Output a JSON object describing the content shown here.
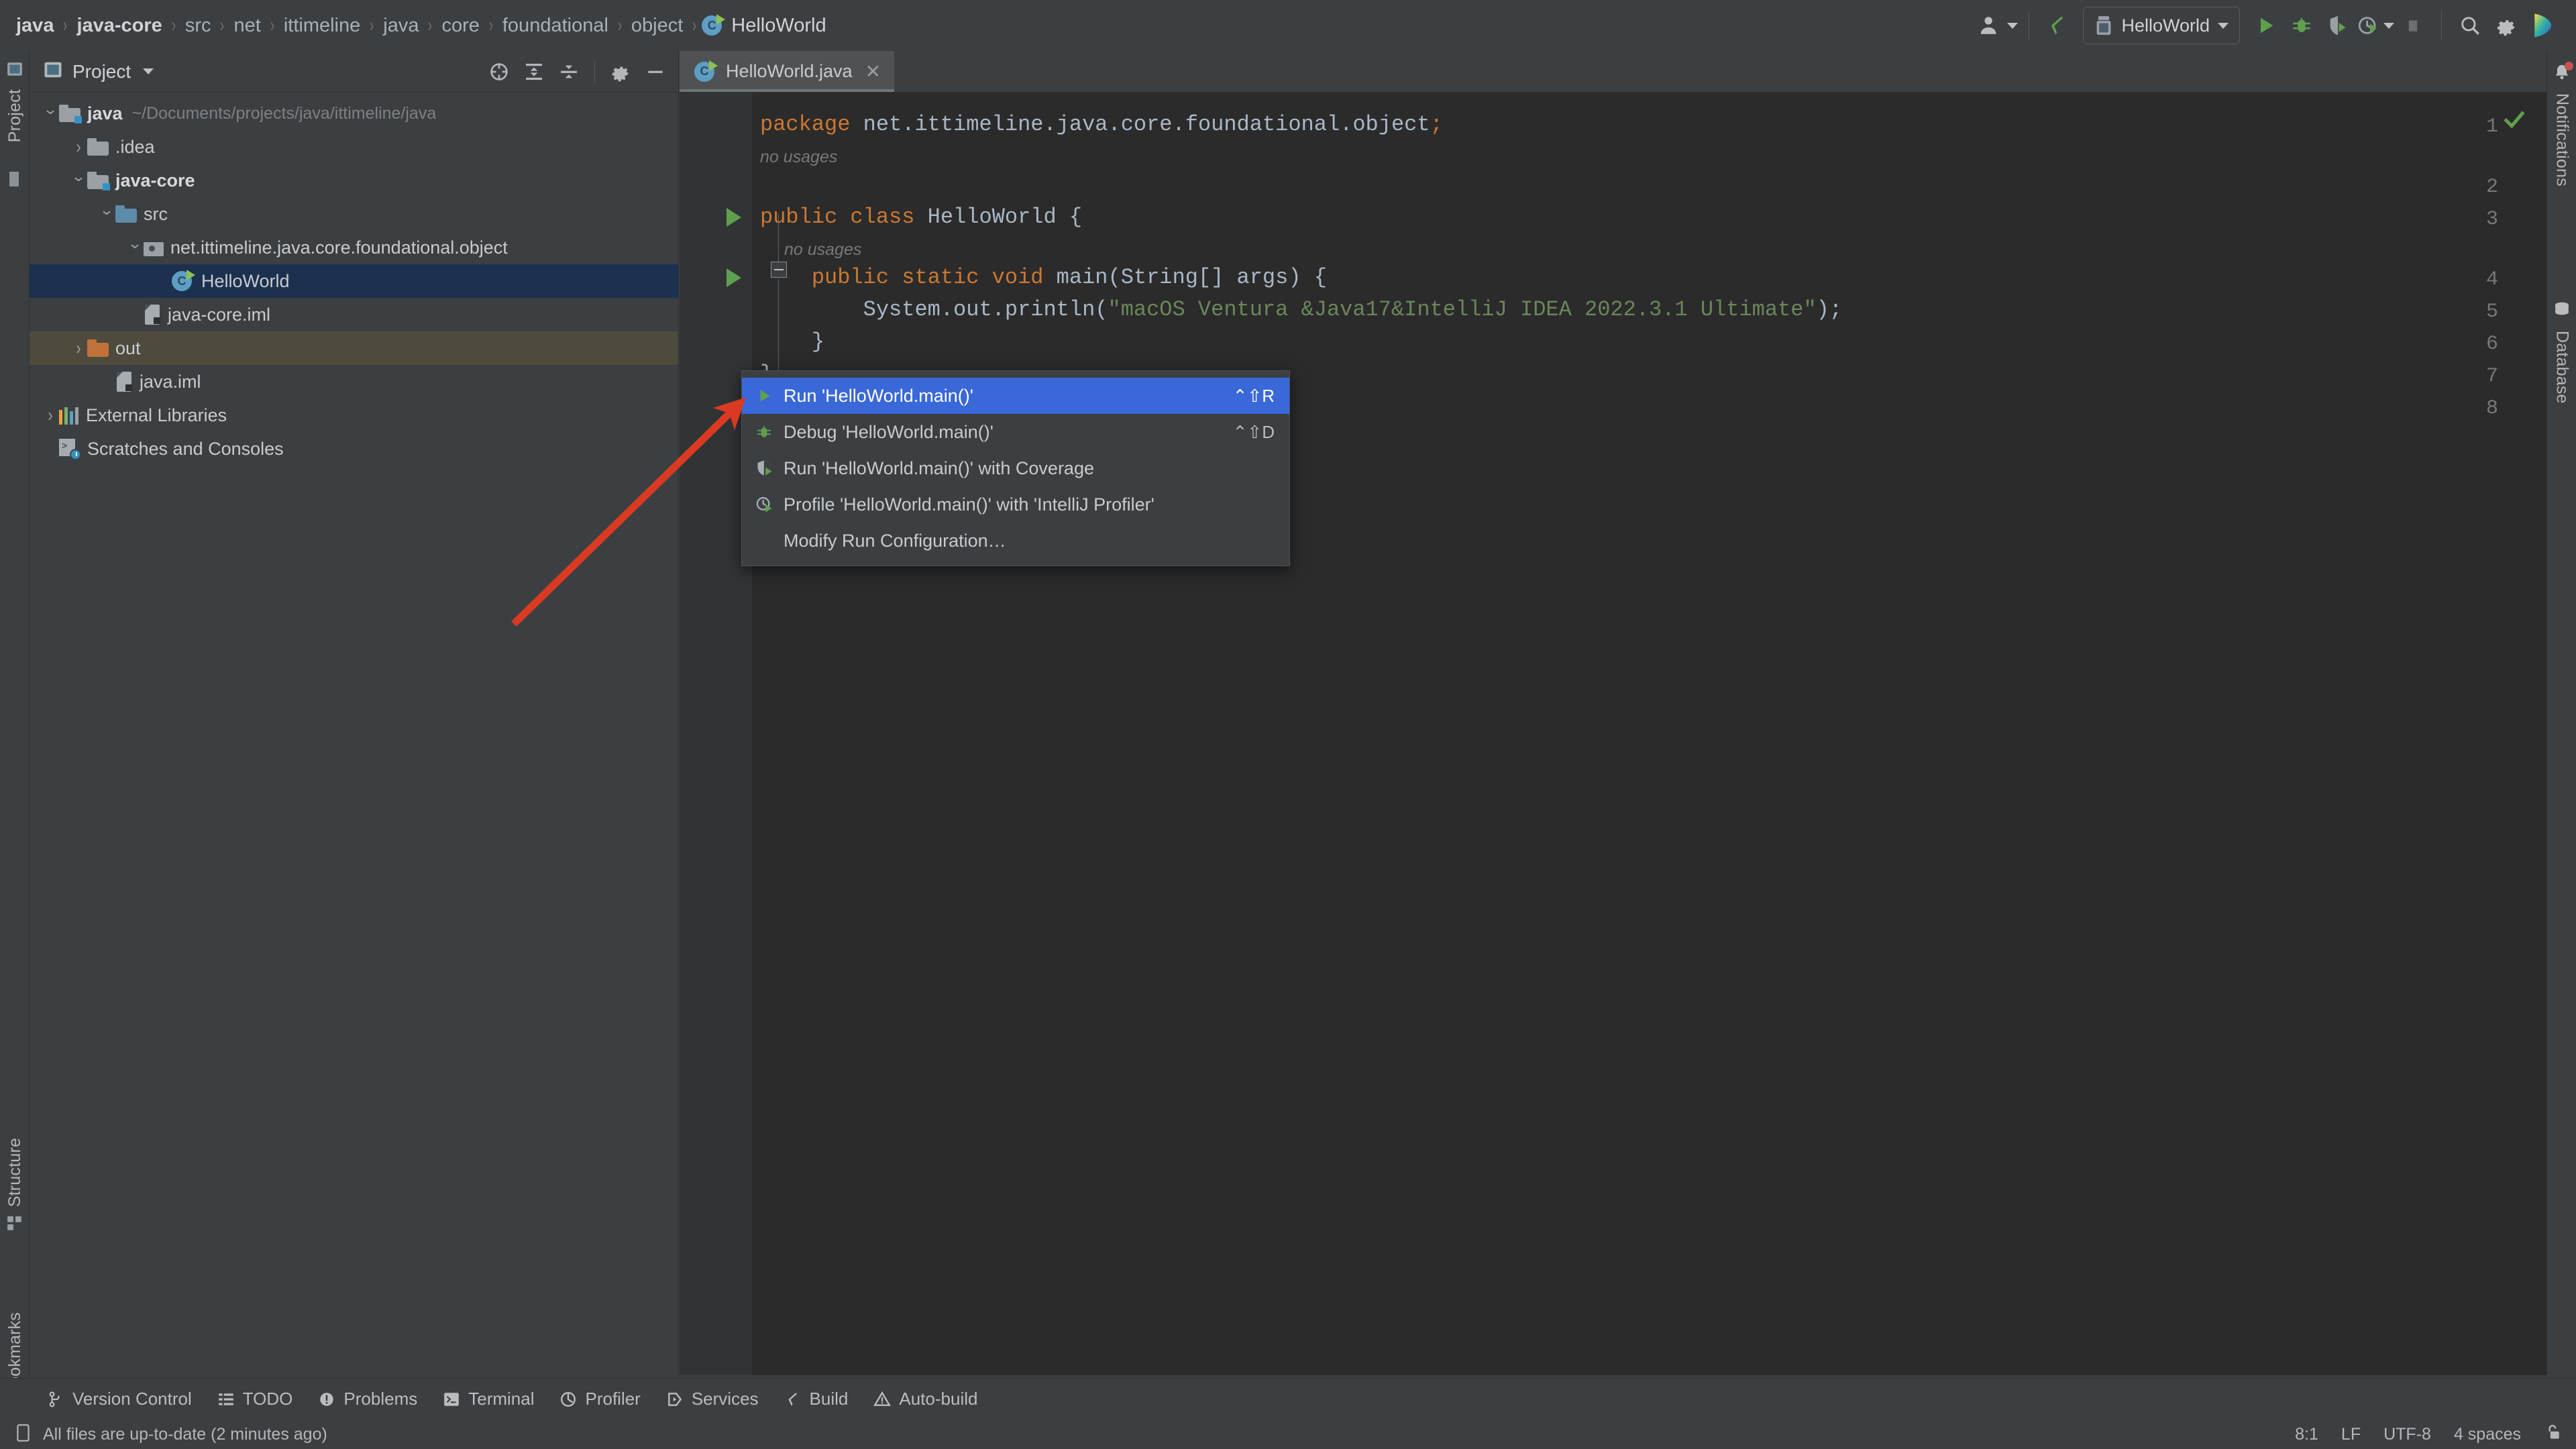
{
  "breadcrumb": {
    "items": [
      {
        "label": "java",
        "bold": true
      },
      {
        "label": "java-core",
        "bold": true
      },
      {
        "label": "src",
        "bold": false
      },
      {
        "label": "net",
        "bold": false
      },
      {
        "label": "ittimeline",
        "bold": false
      },
      {
        "label": "java",
        "bold": false
      },
      {
        "label": "core",
        "bold": false
      },
      {
        "label": "foundational",
        "bold": false
      },
      {
        "label": "object",
        "bold": false
      },
      {
        "label": "HelloWorld",
        "bold": false,
        "icon": "java-class-icon"
      }
    ],
    "separator": "›"
  },
  "toolbar": {
    "account_icon": "user-account-icon",
    "build_icon": "build-hammer-icon",
    "run_config_name": "HelloWorld",
    "run_config_icon": "application-config-icon",
    "run_icon": "run-icon",
    "debug_icon": "debug-bug-icon",
    "coverage_icon": "run-with-coverage-icon",
    "profile_icon": "profiler-icon",
    "stop_icon": "stop-icon",
    "search_icon": "search-icon",
    "settings_icon": "gear-icon",
    "ide_icon": "intellij-logo-icon"
  },
  "left_rail": {
    "items": [
      {
        "label": "Project",
        "icon": "project-panel-icon"
      },
      {
        "label": "",
        "icon": "commit-icon"
      },
      {
        "label": "Structure",
        "icon": "structure-icon"
      },
      {
        "label": "Bookmarks",
        "icon": "bookmark-icon"
      }
    ]
  },
  "right_rail": {
    "items": [
      {
        "label": "Notifications",
        "icon": "notifications-bell-icon",
        "badge": true
      },
      {
        "label": "Database",
        "icon": "database-icon"
      }
    ]
  },
  "project_panel": {
    "title": "Project",
    "title_icon": "project-icon",
    "dropdown_icon": "chevron-down-icon",
    "tools": [
      {
        "name": "select-opened-file-icon"
      },
      {
        "name": "expand-all-icon"
      },
      {
        "name": "collapse-all-icon"
      },
      {
        "name": "gear-icon"
      },
      {
        "name": "hide-icon"
      }
    ],
    "tree": [
      {
        "indent": 0,
        "twist": "expanded",
        "icon": "module-folder-icon",
        "label": "java",
        "bold": true,
        "path": "~/Documents/projects/java/ittimeline/java",
        "state": "none"
      },
      {
        "indent": 1,
        "twist": "collapsed",
        "icon": "folder-icon",
        "label": ".idea",
        "bold": false,
        "path": "",
        "state": "none"
      },
      {
        "indent": 1,
        "twist": "expanded",
        "icon": "module-folder-icon",
        "label": "java-core",
        "bold": true,
        "path": "",
        "state": "none"
      },
      {
        "indent": 2,
        "twist": "expanded",
        "icon": "source-folder-icon",
        "label": "src",
        "bold": false,
        "path": "",
        "state": "none"
      },
      {
        "indent": 3,
        "twist": "expanded",
        "icon": "package-icon",
        "label": "net.ittimeline.java.core.foundational.object",
        "bold": false,
        "path": "",
        "state": "none"
      },
      {
        "indent": 4,
        "twist": "none",
        "icon": "java-class-icon",
        "label": "HelloWorld",
        "bold": false,
        "path": "",
        "state": "selected"
      },
      {
        "indent": 3,
        "twist": "none",
        "icon": "iml-file-icon",
        "label": "java-core.iml",
        "bold": false,
        "path": "",
        "state": "none"
      },
      {
        "indent": 1,
        "twist": "collapsed",
        "icon": "excluded-folder-icon",
        "label": "out",
        "bold": false,
        "path": "",
        "state": "hover"
      },
      {
        "indent": 2,
        "twist": "none",
        "icon": "iml-file-icon",
        "label": "java.iml",
        "bold": false,
        "path": "",
        "state": "none"
      },
      {
        "indent": 0,
        "twist": "collapsed",
        "icon": "libraries-icon",
        "label": "External Libraries",
        "bold": false,
        "path": "",
        "state": "none"
      },
      {
        "indent": 0,
        "twist": "none",
        "icon": "scratches-icon",
        "label": "Scratches and Consoles",
        "bold": false,
        "path": "",
        "state": "none"
      }
    ]
  },
  "editor": {
    "tab": {
      "label": "HelloWorld.java",
      "icon": "java-class-icon",
      "close_icon": "close-icon"
    },
    "inspection_status_icon": "inspection-ok-checkmark",
    "lines": [
      {
        "no": "1",
        "segments": [
          {
            "t": "package",
            "c": "k"
          },
          {
            "t": " net.ittimeline.java.core.foundational.object",
            "c": "pl"
          },
          {
            "t": ";",
            "c": "k"
          }
        ],
        "runmark": false
      },
      {
        "no": "2",
        "segments": [],
        "runmark": false
      },
      {
        "no": "3",
        "segments": [
          {
            "t": "public class ",
            "c": "k"
          },
          {
            "t": "HelloWorld {",
            "c": "pl"
          }
        ],
        "runmark": true
      },
      {
        "no": "4",
        "segments": [
          {
            "t": "    public static void ",
            "c": "k"
          },
          {
            "t": "main(String[] args) {",
            "c": "pl"
          }
        ],
        "runmark": true
      },
      {
        "no": "5",
        "segments": [
          {
            "t": "        System.out.println(",
            "c": "pl"
          },
          {
            "t": "\"macOS Ventura &Java17&IntelliJ IDEA 2022.3.1 Ultimate\"",
            "c": "st"
          },
          {
            "t": ");",
            "c": "pl"
          }
        ],
        "runmark": false
      },
      {
        "no": "6",
        "segments": [
          {
            "t": "    }",
            "c": "pl"
          }
        ],
        "runmark": false
      },
      {
        "no": "7",
        "segments": [
          {
            "t": "}",
            "c": "pl"
          }
        ],
        "runmark": false
      },
      {
        "no": "8",
        "segments": [],
        "runmark": false
      }
    ],
    "inlay_hints": [
      {
        "text": "no usages",
        "line": 2
      },
      {
        "text": "no usages",
        "line": 3
      }
    ]
  },
  "context_menu": {
    "items": [
      {
        "label": "Run 'HelloWorld.main()'",
        "shortcut": "⌃⇧R",
        "icon": "run-icon",
        "active": true
      },
      {
        "label": "Debug 'HelloWorld.main()'",
        "shortcut": "⌃⇧D",
        "icon": "debug-bug-icon",
        "active": false
      },
      {
        "label": "Run 'HelloWorld.main()' with Coverage",
        "shortcut": "",
        "icon": "run-with-coverage-icon",
        "active": false
      },
      {
        "label": "Profile 'HelloWorld.main()' with 'IntelliJ Profiler'",
        "shortcut": "",
        "icon": "profiler-icon",
        "active": false
      },
      {
        "label": "Modify Run Configuration…",
        "shortcut": "",
        "icon": "",
        "active": false
      }
    ]
  },
  "bottom_bar": {
    "items": [
      {
        "label": "Version Control",
        "icon": "version-control-icon"
      },
      {
        "label": "TODO",
        "icon": "todo-list-icon"
      },
      {
        "label": "Problems",
        "icon": "problems-icon"
      },
      {
        "label": "Terminal",
        "icon": "terminal-icon"
      },
      {
        "label": "Profiler",
        "icon": "profiler-icon"
      },
      {
        "label": "Services",
        "icon": "services-icon"
      },
      {
        "label": "Build",
        "icon": "build-hammer-icon"
      },
      {
        "label": "Auto-build",
        "icon": "auto-build-warning-icon"
      }
    ]
  },
  "status_bar": {
    "icon": "file-sync-icon",
    "message": "All files are up-to-date (2 minutes ago)",
    "caret_position": "8:1",
    "line_separator": "LF",
    "encoding": "UTF-8",
    "indent": "4 spaces",
    "lock_icon": "unlocked-padlock-icon"
  },
  "annotation": {
    "arrow_color": "#D93A21",
    "description": "red arrow pointing to Run 'HelloWorld.main()' menu item"
  },
  "colors": {
    "chrome_bg": "#3C3F41",
    "editor_bg": "#2B2B2B",
    "gutter_bg": "#313335",
    "selection_blue": "#1C3050",
    "menu_highlight": "#3A68D8",
    "excluded_hover": "#4E4A3E",
    "keyword": "#CC7832",
    "string": "#6A8759",
    "plain_text": "#A9B7C6",
    "run_green": "#5FA04E",
    "accent_blue": "#3592C4"
  }
}
